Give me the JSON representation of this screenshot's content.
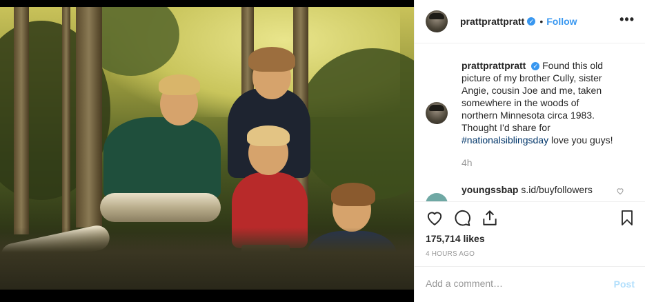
{
  "post": {
    "username": "prattprattpratt",
    "verified_badge": "✓",
    "separator": "•",
    "follow_label": "Follow",
    "more_label": "•••"
  },
  "caption": {
    "username": "prattprattpratt",
    "text_before_tag": "Found this old picture of my brother Cully, sister Angie, cousin Joe and me, taken somewhere in the woods of northern Minnesota circa 1983. Thought I'd share for ",
    "hashtag": "#nationalsiblingsday",
    "text_after_tag": " love you guys!",
    "time": "4h"
  },
  "comment": {
    "username": "youngssbap",
    "text": "s.id/buyfollowers"
  },
  "stats": {
    "likes": "175,714 likes",
    "posted_ago": "4 HOURS AGO"
  },
  "comment_box": {
    "placeholder": "Add a comment…",
    "post_label": "Post"
  },
  "icons": {
    "like": "heart-icon",
    "comment": "comment-bubble-icon",
    "share": "share-icon",
    "save": "bookmark-icon"
  },
  "colors": {
    "link": "#3897f0",
    "hashtag": "#003569",
    "muted": "#999999",
    "post_disabled": "#b2dffc"
  }
}
